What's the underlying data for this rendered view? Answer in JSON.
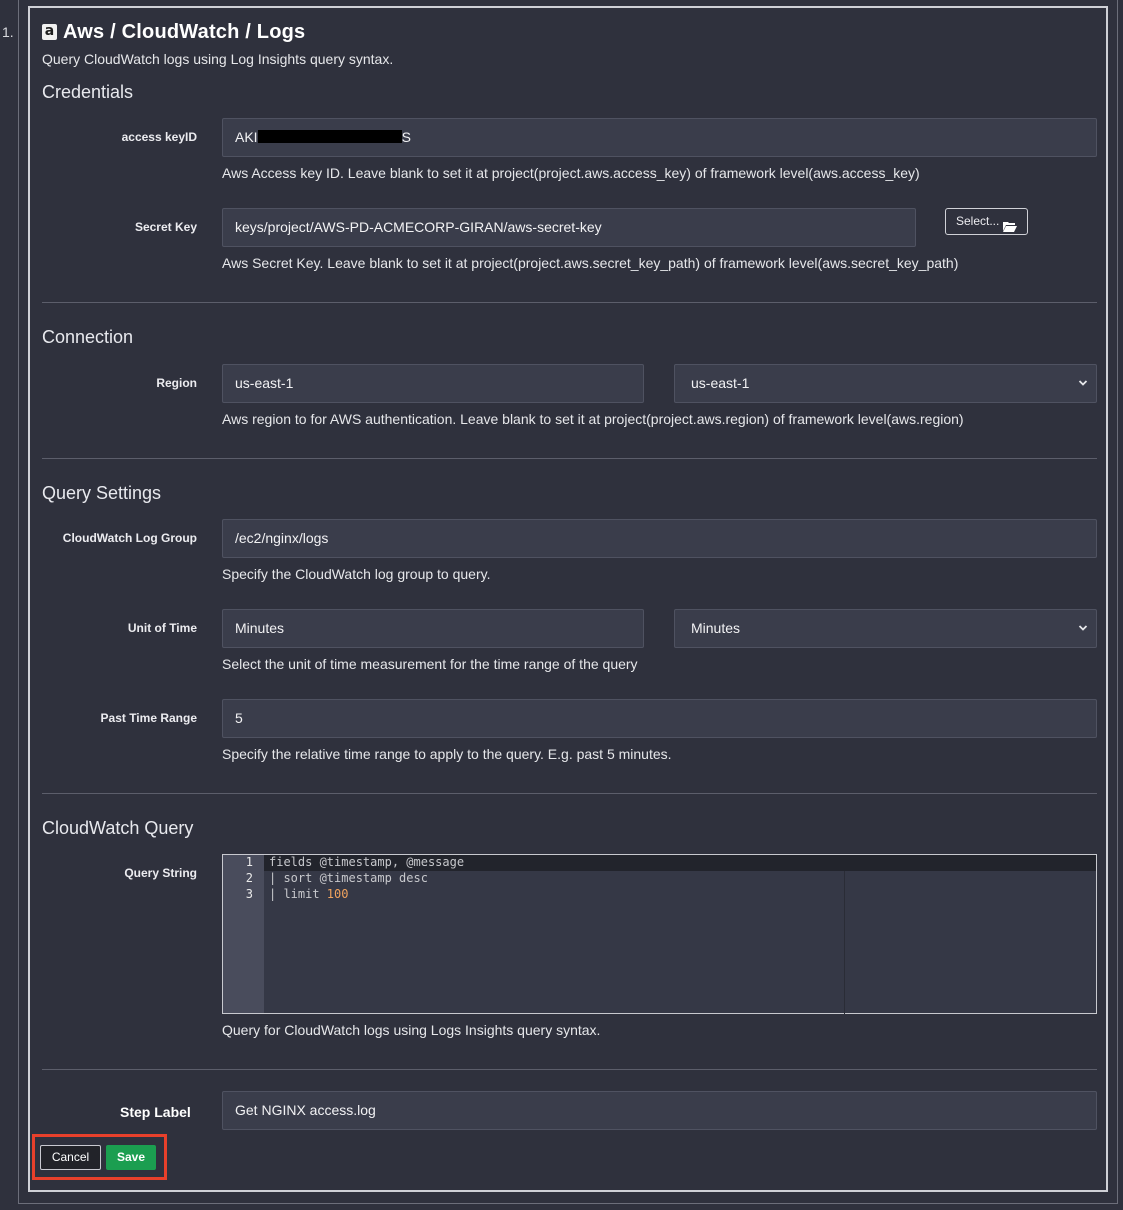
{
  "step": {
    "number": "1."
  },
  "header": {
    "icon": "aws-icon",
    "icon_glyph": "a",
    "title": "Aws / CloudWatch / Logs",
    "description": "Query CloudWatch logs using Log Insights query syntax."
  },
  "credentials": {
    "section_title": "Credentials",
    "access_key": {
      "label": "access keyID",
      "value_prefix": "AKI",
      "value_suffix": "S",
      "help": "Aws Access key ID. Leave blank to set it at project(project.aws.access_key) of framework level(aws.access_key)"
    },
    "secret_key": {
      "label": "Secret Key",
      "value": "keys/project/AWS-PD-ACMECORP-GIRAN/aws-secret-key",
      "select_button": "Select...",
      "help": "Aws Secret Key. Leave blank to set it at project(project.aws.secret_key_path) of framework level(aws.secret_key_path)"
    }
  },
  "connection": {
    "section_title": "Connection",
    "region": {
      "label": "Region",
      "value": "us-east-1",
      "selected": "us-east-1",
      "help": "Aws region to for AWS authentication. Leave blank to set it at project(project.aws.region) of framework level(aws.region)"
    }
  },
  "query_settings": {
    "section_title": "Query Settings",
    "log_group": {
      "label": "CloudWatch Log Group",
      "value": "/ec2/nginx/logs",
      "help": "Specify the CloudWatch log group to query."
    },
    "unit_of_time": {
      "label": "Unit of Time",
      "value": "Minutes",
      "selected": "Minutes",
      "help": "Select the unit of time measurement for the time range of the query"
    },
    "past_time_range": {
      "label": "Past Time Range",
      "value": "5",
      "help": "Specify the relative time range to apply to the query. E.g. past 5 minutes."
    }
  },
  "cloudwatch_query": {
    "section_title": "CloudWatch Query",
    "query_string": {
      "label": "Query String",
      "line_numbers": [
        "1",
        "2",
        "3"
      ],
      "lines": [
        "fields @timestamp, @message",
        "| sort @timestamp desc",
        "| limit "
      ],
      "limit_value": "100",
      "help": "Query for CloudWatch logs using Logs Insights query syntax."
    }
  },
  "step_label": {
    "label": "Step Label",
    "value": "Get NGINX access.log"
  },
  "actions": {
    "cancel": "Cancel",
    "save": "Save"
  },
  "colors": {
    "background": "#2f313d",
    "input_background": "#3a3d4b",
    "save_button": "#1b9e50",
    "highlight_border": "#e8402b",
    "number_token": "#f0a35e"
  }
}
